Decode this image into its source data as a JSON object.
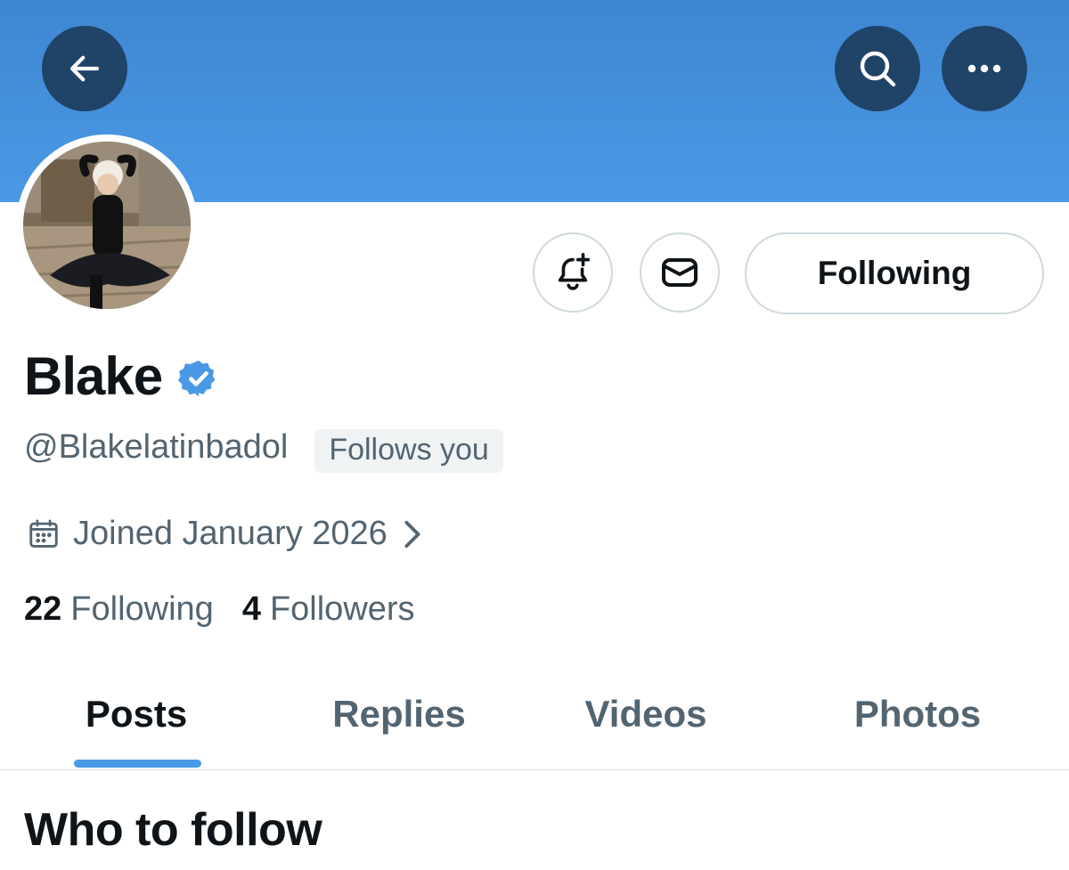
{
  "header": {
    "back_icon": "arrow-left-icon",
    "search_icon": "search-icon",
    "more_icon": "more-horizontal-icon",
    "banner_color": "#4a99e6",
    "button_color": "#1f4468"
  },
  "profile": {
    "display_name": "Blake",
    "verified_icon": "verified-badge-icon",
    "verified_color": "#4a99e6",
    "handle": "@Blakelatinbadol",
    "follows_you": "Follows you",
    "joined": "Joined January 2026"
  },
  "actions": {
    "notify_icon": "bell-plus-icon",
    "message_icon": "envelope-icon",
    "following_label": "Following"
  },
  "stats": {
    "following_count": "22",
    "following_label": "Following",
    "followers_count": "4",
    "followers_label": "Followers"
  },
  "tabs": [
    {
      "label": "Posts",
      "active": true
    },
    {
      "label": "Replies",
      "active": false
    },
    {
      "label": "Videos",
      "active": false
    },
    {
      "label": "Photos",
      "active": false
    }
  ],
  "sections": {
    "who_to_follow": "Who to follow"
  }
}
